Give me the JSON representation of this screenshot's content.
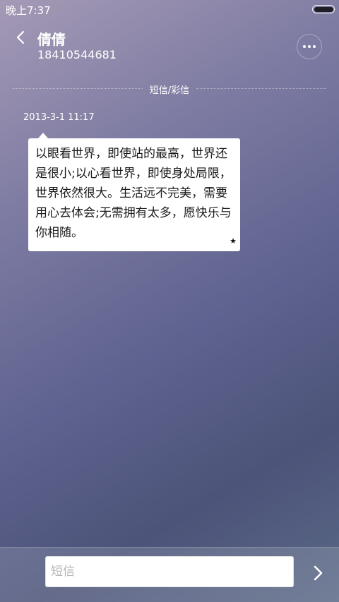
{
  "status_bar": {
    "time": "晚上7:37"
  },
  "header": {
    "contact_name": "倩倩",
    "contact_number": "18410544681"
  },
  "divider": {
    "label": "短信/彩信"
  },
  "messages": [
    {
      "timestamp": "2013-3-1 11:17",
      "text": "以眼看世界，即使站的最高，世界还是很小;以心看世界，即使身处局限，世界依然很大。生活远不完美，需要用心去体会;无需拥有太多，愿快乐与你相随。",
      "starred_glyph": "★"
    }
  ],
  "composer": {
    "placeholder": "短信",
    "value": ""
  },
  "icons": {
    "back": "chevron-left-icon",
    "more": "more-dots-icon",
    "send": "chevron-right-icon",
    "battery": "battery-icon",
    "star": "star-icon"
  },
  "colors": {
    "background_top": "#a59ab6",
    "background_mid": "#5f6390",
    "background_bottom": "#4c5479",
    "bubble": "#ffffff",
    "text_on_bg": "#ffffff"
  }
}
